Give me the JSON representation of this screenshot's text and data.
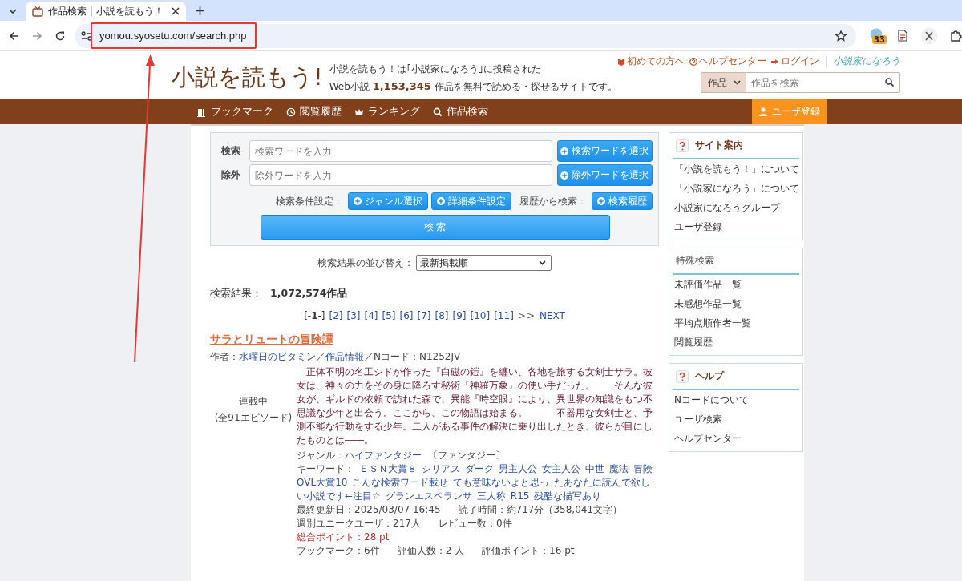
{
  "browser": {
    "tab_title": "作品検索 | 小説を読もう！",
    "url": "yomou.syosetu.com/search.php",
    "extension_badge": "33"
  },
  "header": {
    "logo": "小説を読もう!",
    "tagline": "小説を読もう！は｢小説家になろう｣に投稿された",
    "count_prefix": "Web小説",
    "count": "1,153,345",
    "count_suffix": "作品を無料で読める・探せるサイトです。",
    "top_links": [
      {
        "kind": "beginner",
        "label": "初めての方へ"
      },
      {
        "kind": "help",
        "label": "ヘルプセンター"
      },
      {
        "kind": "login",
        "label": "ログイン"
      }
    ],
    "sister_logo": "小説家になろう",
    "search": {
      "category": "作品",
      "placeholder": "作品を検索"
    }
  },
  "nav": {
    "items": [
      {
        "kind": "bookmark",
        "label": "ブックマーク"
      },
      {
        "kind": "history",
        "label": "閲覧履歴"
      },
      {
        "kind": "ranking",
        "label": "ランキング"
      },
      {
        "kind": "search",
        "label": "作品検索"
      }
    ],
    "register": "ユーザ登録"
  },
  "search_form": {
    "rows": [
      {
        "label": "検索",
        "placeholder": "検索ワードを入力",
        "button": "検索ワードを選択"
      },
      {
        "label": "除外",
        "placeholder": "除外ワードを入力",
        "button": "除外ワードを選択"
      }
    ],
    "condition_label": "検索条件設定：",
    "condition_buttons": [
      "ジャンル選択",
      "詳細条件設定"
    ],
    "history_label": "履歴から検索：",
    "history_button": "検索履歴",
    "submit": "検 索"
  },
  "sort": {
    "label": "検索結果の並び替え：",
    "value": "最新掲載順"
  },
  "results": {
    "label": "検索結果：",
    "count": "1,072,574作品"
  },
  "pagination": {
    "pages": [
      {
        "label": "[-**1**-]",
        "selected": true
      },
      {
        "label": "[2]",
        "selected": false
      },
      {
        "label": "[3]",
        "selected": false
      },
      {
        "label": "[4]",
        "selected": false
      },
      {
        "label": "[5]",
        "selected": false
      },
      {
        "label": "[6]",
        "selected": false
      },
      {
        "label": "[7]",
        "selected": false
      },
      {
        "label": "[8]",
        "selected": false
      },
      {
        "label": "[9]",
        "selected": false
      },
      {
        "label": "[10]",
        "selected": false
      },
      {
        "label": "[11]",
        "selected": false
      }
    ],
    "arrows": ">>",
    "next": "NEXT"
  },
  "novel": {
    "title": "サラとリュートの冒険譚",
    "author_label": "作者：",
    "author": "水曜日のビタミン",
    "separator": "／",
    "info_link": "作品情報",
    "ncode": "／Nコード：N1252JV",
    "status": "連載中",
    "episodes": "(全91エピソード)",
    "synopsis": "　正体不明の名工シドが作った『白磁の鎧』を纏い、各地を旅する女剣士サラ。彼女は、神々の力をその身に降ろす秘術『神羅万象』の使い手だった。　　そんな彼女が、ギルドの依頼で訪れた森で、異能『時空眼』により、異世界の知識をもつ不思議な少年と出会う。ここから、この物語は始まる。　　　不器用な女剣士と、予測不能な行動をする少年。二人がある事件の解決に乗り出したとき、彼らが目にしたものとは――。",
    "genre_label": "ジャンル：",
    "genre": "ハイファンタジー",
    "genre_parent": "〔ファンタジー〕",
    "keyword_label": "キーワード：",
    "keywords": [
      "ＥＳＮ大賞８",
      "シリアス",
      "ダーク",
      "男主人公",
      "女主人公",
      "中世",
      "魔法",
      "冒険",
      "OVL大賞10",
      "こんな検索ワード載せ",
      "ても意味ないよと思っ",
      "たあなたに読んで欲し",
      "い小説です←注目☆",
      "グランエスペランサ",
      "三人称",
      "R15",
      "残酷な描写あり"
    ],
    "stats": [
      [
        {
          "text": "最終更新日：2025/03/07 16:45",
          "emphasis": false
        },
        {
          "text": "読了時間：約717分（358,041文字）",
          "emphasis": false
        }
      ],
      [
        {
          "text": "週別ユニークユーザ：217人",
          "emphasis": false
        },
        {
          "text": "レビュー数：0件",
          "emphasis": false
        }
      ],
      [
        {
          "text": "総合ポイント：28 pt",
          "emphasis": true
        }
      ],
      [
        {
          "text": "ブックマーク：6件",
          "emphasis": false
        },
        {
          "text": "評価人数：2 人",
          "emphasis": false
        },
        {
          "text": "評価ポイント：16 pt",
          "emphasis": false
        }
      ]
    ]
  },
  "sidebar": [
    {
      "kind": "help",
      "title": "サイト案内",
      "items": [
        "「小説を読もう！」について",
        "「小説家になろう」について",
        "小説家になろうグループ",
        "ユーザ登録"
      ]
    },
    {
      "kind": "plain",
      "title": "特殊検索",
      "items": [
        "未評価作品一覧",
        "未感想作品一覧",
        "平均点順作者一覧",
        "閲覧履歴"
      ]
    },
    {
      "kind": "help",
      "title": "ヘルプ",
      "items": [
        "Nコードについて",
        "ユーザ検索",
        "ヘルプセンター"
      ]
    }
  ]
}
